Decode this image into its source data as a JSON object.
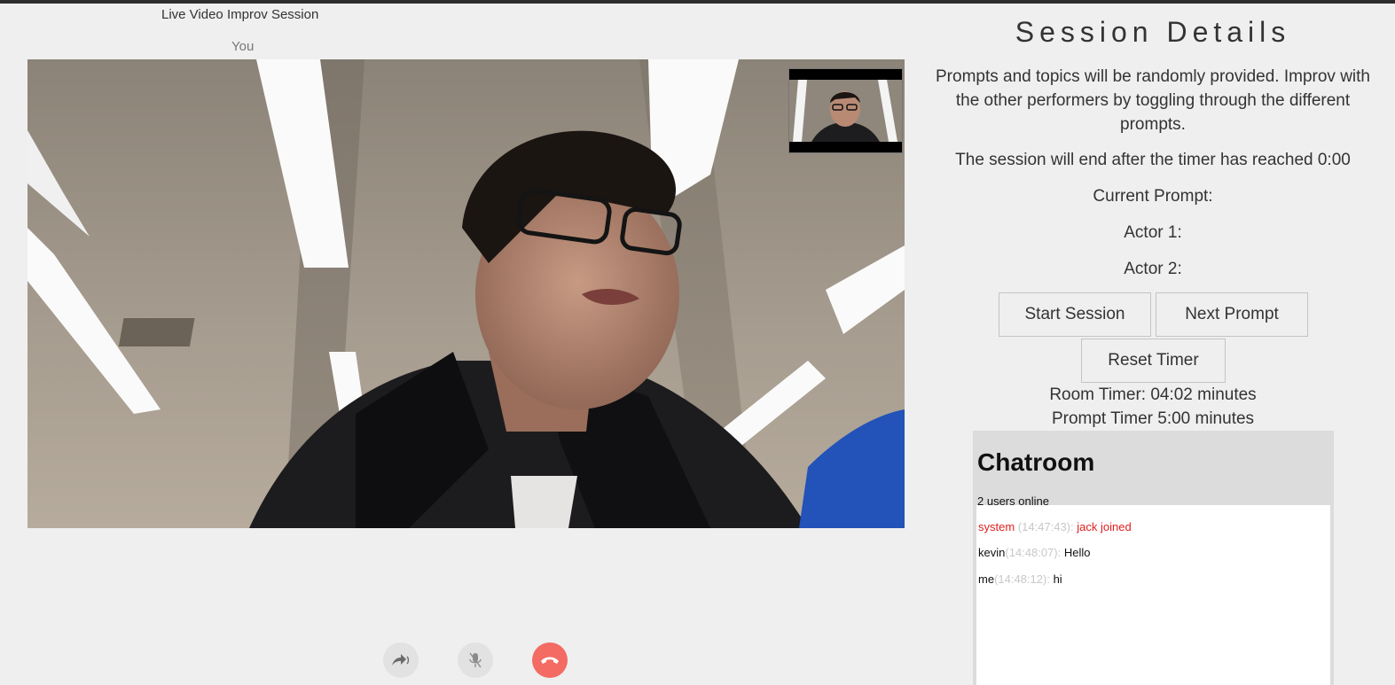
{
  "left_panel": {
    "title": "Live Video Improv Session",
    "you_label": "You"
  },
  "controls": {
    "share_icon": "share-arrow-icon",
    "mute_icon": "microphone-muted-icon",
    "hangup_icon": "phone-hangup-icon",
    "hangup_color": "#f36b63"
  },
  "session": {
    "title": "Session Details",
    "description": "Prompts and topics will be randomly provided. Improv with the other performers by toggling through the different prompts.",
    "end_note": "The session will end after the timer has reached 0:00",
    "current_prompt_label": "Current Prompt:",
    "actor1_label": "Actor 1:",
    "actor2_label": "Actor 2:",
    "start_button": "Start Session",
    "next_button": "Next Prompt",
    "reset_button": "Reset Timer",
    "room_timer": "Room Timer: 04:02 minutes",
    "prompt_timer": "Prompt Timer 5:00 minutes"
  },
  "chat": {
    "title": "Chatroom",
    "online": "2 users online",
    "messages": [
      {
        "name": "system",
        "time": " (14:47:43): ",
        "text": "jack joined"
      },
      {
        "name": "kevin",
        "time": "(14:48:07): ",
        "text": "Hello"
      },
      {
        "name": "me",
        "time": "(14:48:12): ",
        "text": "hi"
      }
    ],
    "system_color": "#e02020"
  }
}
